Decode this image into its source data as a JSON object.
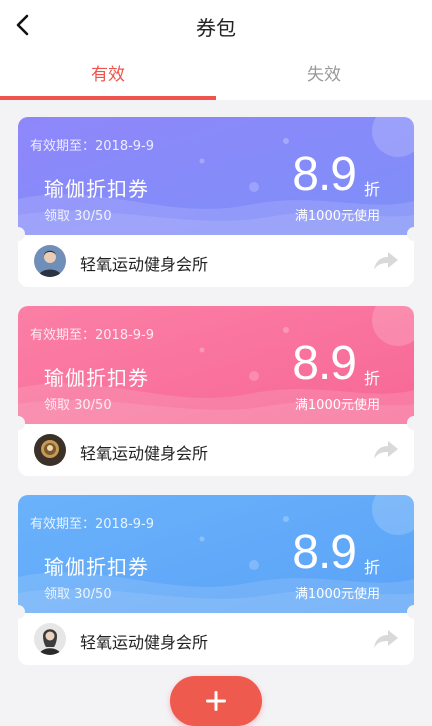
{
  "header": {
    "title": "券包"
  },
  "tabs": [
    {
      "label": "有效",
      "active": true
    },
    {
      "label": "失效",
      "active": false
    }
  ],
  "coupons": [
    {
      "expiry": "有效期至：2018-9-9",
      "name": "瑜伽折扣券",
      "claim": "领取 30/50",
      "discount": "8.9",
      "unit": "折",
      "condition": "满1000元使用",
      "gym": "轻氧运动健身会所",
      "gradient": [
        "#8f87fb",
        "#7d8ff8"
      ]
    },
    {
      "expiry": "有效期至：2018-9-9",
      "name": "瑜伽折扣券",
      "claim": "领取 30/50",
      "discount": "8.9",
      "unit": "折",
      "condition": "满1000元使用",
      "gym": "轻氧运动健身会所",
      "gradient": [
        "#fb7fa6",
        "#f76795"
      ]
    },
    {
      "expiry": "有效期至：2018-9-9",
      "name": "瑜伽折扣券",
      "claim": "领取 30/50",
      "discount": "8.9",
      "unit": "折",
      "condition": "满1000元使用",
      "gym": "轻氧运动健身会所",
      "gradient": [
        "#6bb2fb",
        "#5aa2f7"
      ]
    }
  ],
  "colors": {
    "accent": "#f0524d",
    "add_button": "#ef5a4f"
  },
  "icons": {
    "back": "chevron-left-icon",
    "share": "share-arrow-icon",
    "add": "plus-icon"
  }
}
